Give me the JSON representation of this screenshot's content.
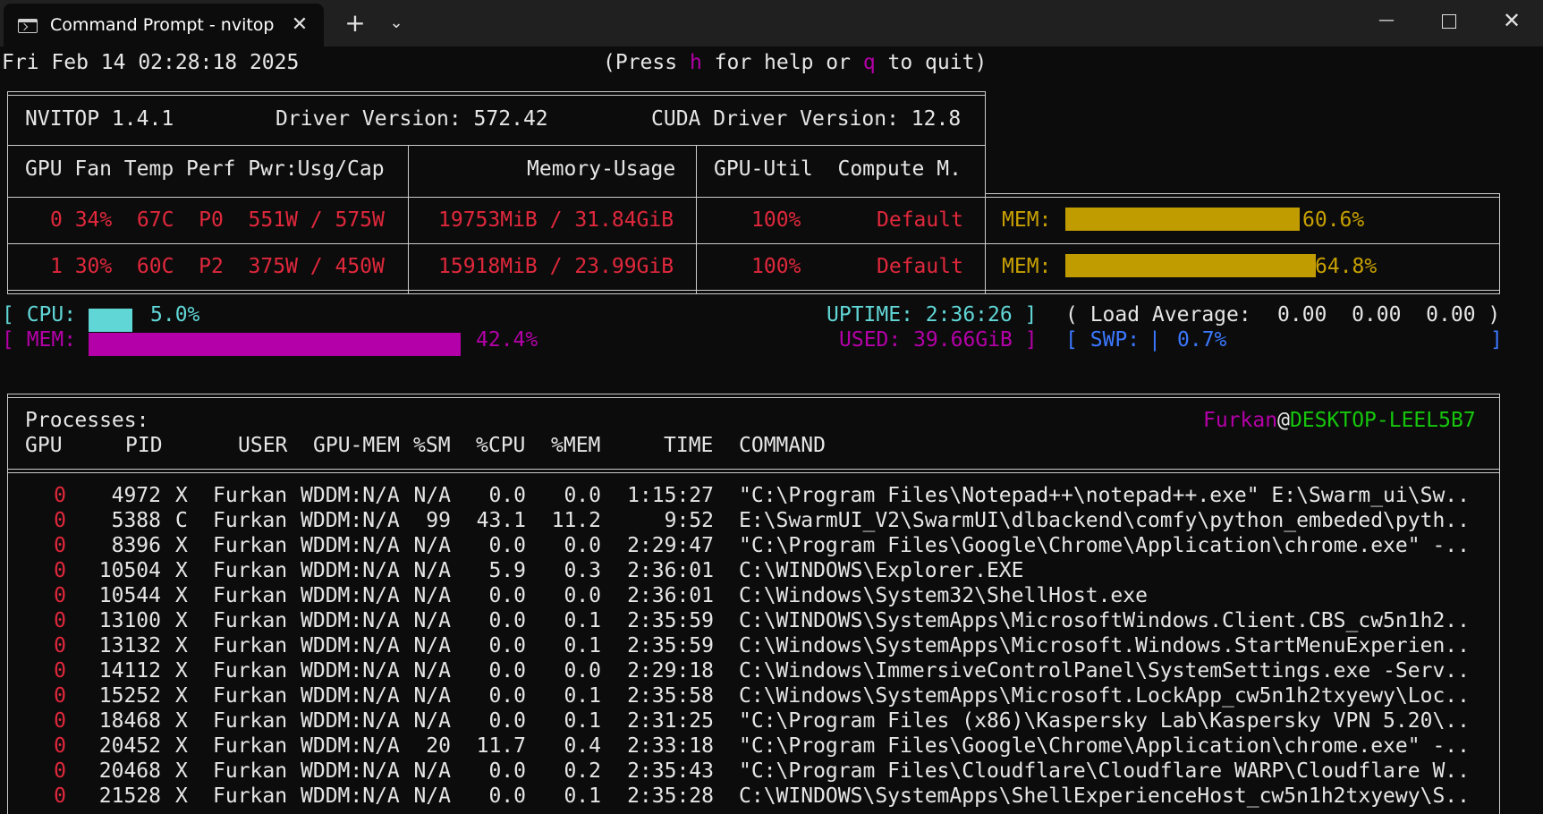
{
  "window": {
    "tab_title": "Command Prompt - nvitop",
    "tab_close": "✕",
    "new_tab": "+",
    "dropdown": "⌄",
    "minimize": "—",
    "close": "✕"
  },
  "header": {
    "datetime": "Fri Feb 14 02:28:18 2025",
    "help_pre": "(Press ",
    "help_h": "h",
    "help_mid": " for help or ",
    "help_q": "q",
    "help_post": " to quit)"
  },
  "gpu_panel": {
    "version": "NVITOP 1.4.1",
    "driver": "Driver Version: 572.42",
    "cuda": "CUDA Driver Version: 12.8",
    "col_left": "GPU Fan Temp Perf Pwr:Usg/Cap",
    "col_mem": "Memory-Usage",
    "col_util": "GPU-Util  Compute M.",
    "gpus": [
      {
        "left": "0 34%  67C  P0  551W / 575W",
        "mem": "19753MiB / 31.84GiB",
        "util": "100%",
        "mode": "Default",
        "mem_label": "MEM:",
        "mem_pct": "60.6%",
        "mem_fraction": 0.606
      },
      {
        "left": "1 30%  60C  P2  375W / 450W",
        "mem": "15918MiB / 23.99GiB",
        "util": "100%",
        "mode": "Default",
        "mem_label": "MEM:",
        "mem_pct": "64.8%",
        "mem_fraction": 0.648
      }
    ]
  },
  "host": {
    "cpu_open": "[ CPU:",
    "cpu_pct": "5.0%",
    "cpu_fraction": 0.05,
    "mem_open": "[ MEM:",
    "mem_pct": "42.4%",
    "mem_fraction": 0.424,
    "uptime": "UPTIME: 2:36:26 ]",
    "used": "USED: 39.66GiB ]",
    "load_label": "( Load Average:",
    "load_values": "0.00  0.00  0.00 )",
    "swp_open": "[ SWP:",
    "swp_bar": "|",
    "swp_pct": "0.7%",
    "swp_close": "]"
  },
  "processes": {
    "title": "Processes:",
    "user": "Furkan",
    "at": "@",
    "host": "DESKTOP-LEEL5B7",
    "columns": {
      "gpu": "GPU",
      "pid": "PID",
      "user": "USER",
      "gpumem": "GPU-MEM",
      "sm": "%SM",
      "cpu": "%CPU",
      "mem": "%MEM",
      "time": "TIME",
      "command": "COMMAND"
    },
    "rows": [
      {
        "gpu": "0",
        "pid": "4972",
        "type": "X",
        "user": "Furkan",
        "gpumem": "WDDM:N/A",
        "sm": "N/A",
        "cpu": "0.0",
        "mem": "0.0",
        "time": "1:15:27",
        "command": "\"C:\\Program Files\\Notepad++\\notepad++.exe\" E:\\Swarm_ui\\Sw.."
      },
      {
        "gpu": "0",
        "pid": "5388",
        "type": "C",
        "user": "Furkan",
        "gpumem": "WDDM:N/A",
        "sm": "99",
        "cpu": "43.1",
        "mem": "11.2",
        "time": "9:52",
        "command": "E:\\SwarmUI_V2\\SwarmUI\\dlbackend\\comfy\\python_embeded\\pyth.."
      },
      {
        "gpu": "0",
        "pid": "8396",
        "type": "X",
        "user": "Furkan",
        "gpumem": "WDDM:N/A",
        "sm": "N/A",
        "cpu": "0.0",
        "mem": "0.0",
        "time": "2:29:47",
        "command": "\"C:\\Program Files\\Google\\Chrome\\Application\\chrome.exe\" -.."
      },
      {
        "gpu": "0",
        "pid": "10504",
        "type": "X",
        "user": "Furkan",
        "gpumem": "WDDM:N/A",
        "sm": "N/A",
        "cpu": "5.9",
        "mem": "0.3",
        "time": "2:36:01",
        "command": "C:\\WINDOWS\\Explorer.EXE"
      },
      {
        "gpu": "0",
        "pid": "10544",
        "type": "X",
        "user": "Furkan",
        "gpumem": "WDDM:N/A",
        "sm": "N/A",
        "cpu": "0.0",
        "mem": "0.0",
        "time": "2:36:01",
        "command": "C:\\Windows\\System32\\ShellHost.exe"
      },
      {
        "gpu": "0",
        "pid": "13100",
        "type": "X",
        "user": "Furkan",
        "gpumem": "WDDM:N/A",
        "sm": "N/A",
        "cpu": "0.0",
        "mem": "0.1",
        "time": "2:35:59",
        "command": "C:\\WINDOWS\\SystemApps\\MicrosoftWindows.Client.CBS_cw5n1h2.."
      },
      {
        "gpu": "0",
        "pid": "13132",
        "type": "X",
        "user": "Furkan",
        "gpumem": "WDDM:N/A",
        "sm": "N/A",
        "cpu": "0.0",
        "mem": "0.1",
        "time": "2:35:59",
        "command": "C:\\Windows\\SystemApps\\Microsoft.Windows.StartMenuExperien.."
      },
      {
        "gpu": "0",
        "pid": "14112",
        "type": "X",
        "user": "Furkan",
        "gpumem": "WDDM:N/A",
        "sm": "N/A",
        "cpu": "0.0",
        "mem": "0.0",
        "time": "2:29:18",
        "command": "C:\\Windows\\ImmersiveControlPanel\\SystemSettings.exe -Serv.."
      },
      {
        "gpu": "0",
        "pid": "15252",
        "type": "X",
        "user": "Furkan",
        "gpumem": "WDDM:N/A",
        "sm": "N/A",
        "cpu": "0.0",
        "mem": "0.1",
        "time": "2:35:58",
        "command": "C:\\Windows\\SystemApps\\Microsoft.LockApp_cw5n1h2txyewy\\Loc.."
      },
      {
        "gpu": "0",
        "pid": "18468",
        "type": "X",
        "user": "Furkan",
        "gpumem": "WDDM:N/A",
        "sm": "N/A",
        "cpu": "0.0",
        "mem": "0.1",
        "time": "2:31:25",
        "command": "\"C:\\Program Files (x86)\\Kaspersky Lab\\Kaspersky VPN 5.20\\.."
      },
      {
        "gpu": "0",
        "pid": "20452",
        "type": "X",
        "user": "Furkan",
        "gpumem": "WDDM:N/A",
        "sm": "20",
        "cpu": "11.7",
        "mem": "0.4",
        "time": "2:33:18",
        "command": "\"C:\\Program Files\\Google\\Chrome\\Application\\chrome.exe\" -.."
      },
      {
        "gpu": "0",
        "pid": "20468",
        "type": "X",
        "user": "Furkan",
        "gpumem": "WDDM:N/A",
        "sm": "N/A",
        "cpu": "0.0",
        "mem": "0.2",
        "time": "2:35:43",
        "command": "\"C:\\Program Files\\Cloudflare\\Cloudflare WARP\\Cloudflare W.."
      },
      {
        "gpu": "0",
        "pid": "21528",
        "type": "X",
        "user": "Furkan",
        "gpumem": "WDDM:N/A",
        "sm": "N/A",
        "cpu": "0.0",
        "mem": "0.1",
        "time": "2:35:28",
        "command": "C:\\WINDOWS\\SystemApps\\ShellExperienceHost_cw5n1h2txyewy\\S.."
      }
    ]
  }
}
